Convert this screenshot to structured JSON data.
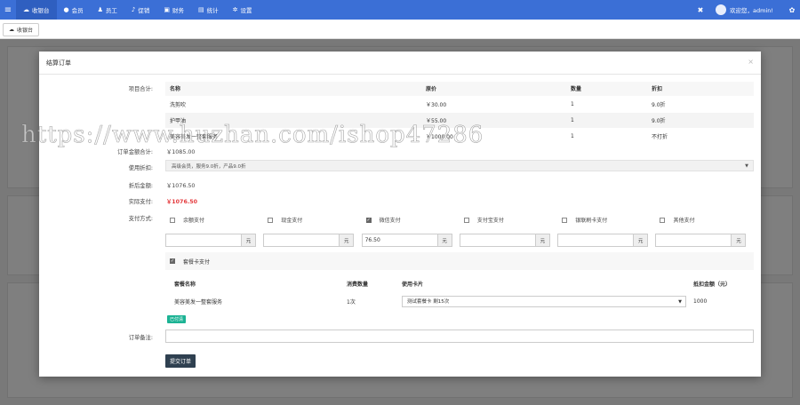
{
  "nav": {
    "menu_icon": "menu-icon",
    "items": [
      {
        "label": "收银台",
        "icon": "cloud-icon",
        "active": true
      },
      {
        "label": "会员",
        "icon": "user-icon",
        "active": false
      },
      {
        "label": "员工",
        "icon": "users-icon",
        "active": false
      },
      {
        "label": "促销",
        "icon": "bell-icon",
        "active": false
      },
      {
        "label": "财务",
        "icon": "wallet-icon",
        "active": false
      },
      {
        "label": "统计",
        "icon": "chart-icon",
        "active": false
      },
      {
        "label": "设置",
        "icon": "gear-icon",
        "active": false
      }
    ],
    "welcome": "欢迎您，admin!",
    "brand_color": "#3b6fd6"
  },
  "tabbar": {
    "tab_label": "收银台"
  },
  "modal": {
    "title": "结算订单",
    "close": "×",
    "labels": {
      "items_total": "项目合计:",
      "order_total": "订单金额合计:",
      "discount": "使用折扣:",
      "after_discount": "折后金额:",
      "actual": "实际支付:",
      "pay_method": "支付方式:",
      "remark": "订单备注:"
    },
    "items_table": {
      "headers": [
        "名称",
        "原价",
        "数量",
        "折扣"
      ],
      "rows": [
        [
          "洗剪吹",
          "￥30.00",
          "1",
          "9.0折"
        ],
        [
          "护甲油",
          "￥55.00",
          "1",
          "9.0折"
        ],
        [
          "美容美发一整套服务",
          "￥1000.00",
          "1",
          "不打折"
        ]
      ]
    },
    "order_total": "￥1085.00",
    "discount_select": "高级会员，服务9.0折，产品9.0折",
    "after_discount": "￥1076.50",
    "actual_pay": "￥1076.50",
    "pay_options": [
      {
        "label": "余额支付",
        "checked": false
      },
      {
        "label": "现金支付",
        "checked": false
      },
      {
        "label": "微信支付",
        "checked": true
      },
      {
        "label": "支付宝支付",
        "checked": false
      },
      {
        "label": "银联刷卡支付",
        "checked": false
      },
      {
        "label": "其他支付",
        "checked": false
      }
    ],
    "pay_amounts": [
      "",
      "",
      "76.50",
      "",
      "",
      ""
    ],
    "unit": "元",
    "package_pay": {
      "label": "套餐卡支付",
      "checked": true
    },
    "package_table": {
      "headers": [
        "套餐名称",
        "消费数量",
        "使用卡片",
        "抵扣金额（元）"
      ],
      "row": {
        "name": "美容美发一整套服务",
        "count": "1次",
        "card": "测试套餐卡  剩15次",
        "amount": "1000"
      }
    },
    "badge": "已付清",
    "submit": "提交订单"
  },
  "watermark": "https://www.huzhan.com/ishop47286"
}
